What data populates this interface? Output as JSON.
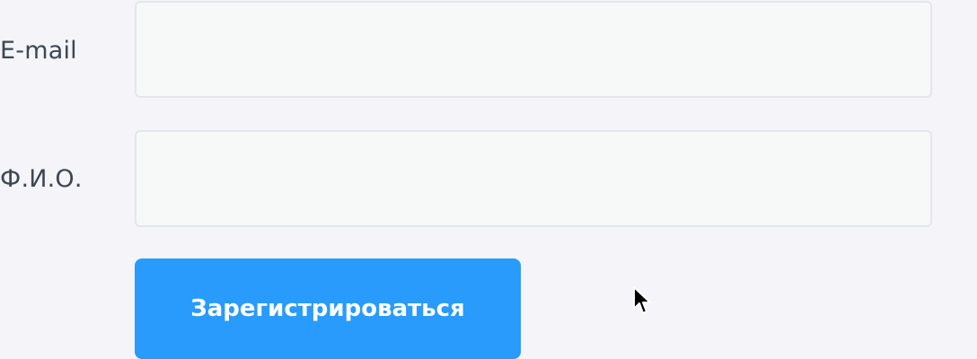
{
  "form": {
    "email_label": "E-mail",
    "email_value": "",
    "fio_label": "Ф.И.О.",
    "fio_value": "",
    "submit_label": "Зарегистрироваться"
  },
  "colors": {
    "accent": "#289bfc",
    "background": "#f5f4f8",
    "label_text": "#3d4654"
  },
  "icons": {
    "cursor": "mouse-pointer-icon"
  }
}
